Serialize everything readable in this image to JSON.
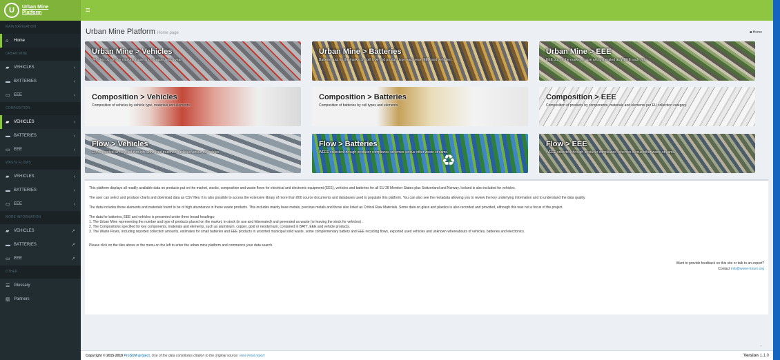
{
  "app": {
    "logo_line1": "Urban Mine",
    "logo_line2": "Platform",
    "logo_mark": "U"
  },
  "header": {
    "menu_icon": "≡"
  },
  "sidebar": {
    "main_nav": "MAIN NAVIGATION",
    "home": "Home",
    "urban_mine": "URBAN MINE",
    "um_vehicles": "VEHICLES",
    "um_batteries": "BATTERIES",
    "um_eee": "EEE",
    "composition": "COMPOSITION",
    "c_vehicles": "VEHICLES",
    "c_batteries": "BATTERIES",
    "c_eee": "EEE",
    "waste_flows": "WASTE FLOWS",
    "w_vehicles": "VEHICLES",
    "w_batteries": "BATTERIES",
    "w_eee": "EEE",
    "more_info": "MORE INFORMATION",
    "m_vehicles": "VEHICLES",
    "m_batteries": "BATTERIES",
    "m_eee": "EEE",
    "other": "OTHER",
    "glossary": "Glossary",
    "partners": "Partners"
  },
  "page": {
    "title": "Urban Mine Platform",
    "subtitle": "Home page",
    "breadcrumb": "Home"
  },
  "tiles": [
    {
      "title": "Urban Mine > Vehicles",
      "desc": "Vehicles put on the market, in use and scrapped each year."
    },
    {
      "title": "Urban Mine > Batteries",
      "desc": "Batteries put on the market by cell type and product type each year (EEE and vehicles)."
    },
    {
      "title": "Urban Mine > EEE",
      "desc": "EEE put on the market, in use and generated as WEEE each year."
    },
    {
      "title": "Composition > Vehicles",
      "desc": "Composition of vehicles by vehicle type, materials and elements."
    },
    {
      "title": "Composition > Batteries",
      "desc": "Composition of batteries by cell types and elements."
    },
    {
      "title": "Composition > EEE",
      "desc": "Composition of products by components, materials and elements per EU collection category."
    },
    {
      "title": "Flow > Vehicles",
      "desc": "ELVs reported as recycled through authorised treatment facilities versus other fates."
    },
    {
      "title": "Flow > Batteries",
      "desc": "WEEE collected through producer compliance schemes versus other waste streams."
    },
    {
      "title": "Flow > EEE",
      "desc": "WEEE collected through producer compliance schemes versus other waste streams."
    }
  ],
  "info": {
    "p1": "This platform displays all readily available data on products put on the market, stocks, composition and waste flows for electrical and electronic equipment (EEE), vehicles and batteries for all EU 28 Member States plus Switzerland and Norway. Iceland is also included for vehicles.",
    "p2": "The user can select and produce charts and download data as CSV files. It is also possible to access the extensive library of more than 800 source documents and databases used to populate this platform. You can also see the metadata allowing you to review the key underlying information and to understand the data quality.",
    "p3": "The data includes those elements and materials found to be of high abundance in these waste products. This includes mainly base metals, precious metals and those also listed as Critical Raw Materials. Some data on glass and plastics is also recorded and provided, although this was not a focus of the project.",
    "p4_head": "The data for batteries, EEE and vehicles is presented under three broad headings:",
    "p4_1": "1. The Urban Mine representing the number and type of products placed on the market, in-stock (in use and hibernated) and generated as waste (or leaving the stock for vehicles) .",
    "p4_2": "2. The Compositions specified for key components, materials and elements, such as aluminium, copper, gold or neodymium, contained in BATT, EEE and vehicle products.",
    "p4_3": "3. The Waste Flows, including reported collection amounts, estimates for small batteries and EEE products in unsorted municipal solid waste, some complementary battery and EEE recycling flows, exported used vehicles and unknown whereabouts of vehicles, batteries and electronics.",
    "p5": "Please click on the tiles above or the menu on the left to enter the urban mine platform and commence your data search.",
    "feedback": "Want to provide feedback on this site or talk to an expert?",
    "contact_label": "Contact",
    "contact_email": "info@weee-forum.org"
  },
  "footer": {
    "copyright": "Copyright © 2015-2018",
    "project": "ProSUM project.",
    "note": "Use of the data constitutes citation to the original source:",
    "final_report": "view Final report",
    "version_label": "Version",
    "version": "1.1.0"
  }
}
